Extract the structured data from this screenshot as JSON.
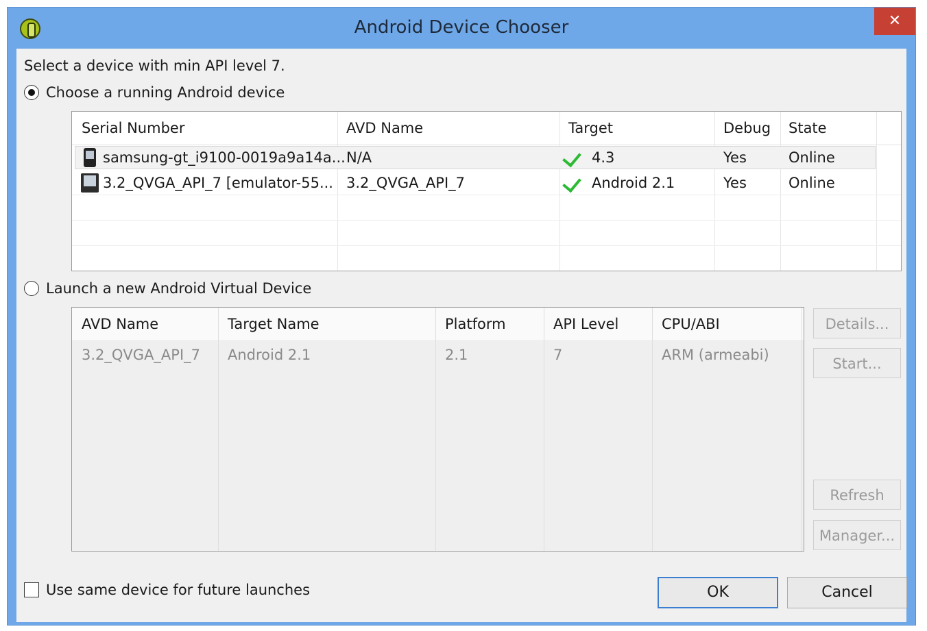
{
  "window": {
    "title": "Android Device Chooser",
    "close_label": "✕"
  },
  "prompt": "Select a device with min API level 7.",
  "running": {
    "radio_label": "Choose a running Android device",
    "columns": [
      "Serial Number",
      "AVD Name",
      "Target",
      "Debug",
      "State"
    ],
    "rows": [
      {
        "icon": "phone-icon",
        "serial": "samsung-gt_i9100-0019a9a14a...",
        "avd": "N/A",
        "target": "4.3",
        "debug": "Yes",
        "state": "Online"
      },
      {
        "icon": "emulator-icon",
        "serial": "3.2_QVGA_API_7 [emulator-55...",
        "avd": "3.2_QVGA_API_7",
        "target": "Android 2.1",
        "debug": "Yes",
        "state": "Online"
      }
    ]
  },
  "launch": {
    "radio_label": "Launch a new Android Virtual Device",
    "columns": [
      "AVD Name",
      "Target Name",
      "Platform",
      "API Level",
      "CPU/ABI"
    ],
    "rows": [
      {
        "avd": "3.2_QVGA_API_7",
        "target": "Android 2.1",
        "platform": "2.1",
        "api": "7",
        "cpu": "ARM (armeabi)"
      }
    ],
    "buttons": {
      "details": "Details...",
      "start": "Start...",
      "refresh": "Refresh",
      "manager": "Manager..."
    }
  },
  "footer": {
    "checkbox_label": "Use same device for future launches",
    "ok": "OK",
    "cancel": "Cancel"
  },
  "colors": {
    "titlebar": "#6fa8e8",
    "close": "#c74034",
    "check": "#2cba33"
  }
}
